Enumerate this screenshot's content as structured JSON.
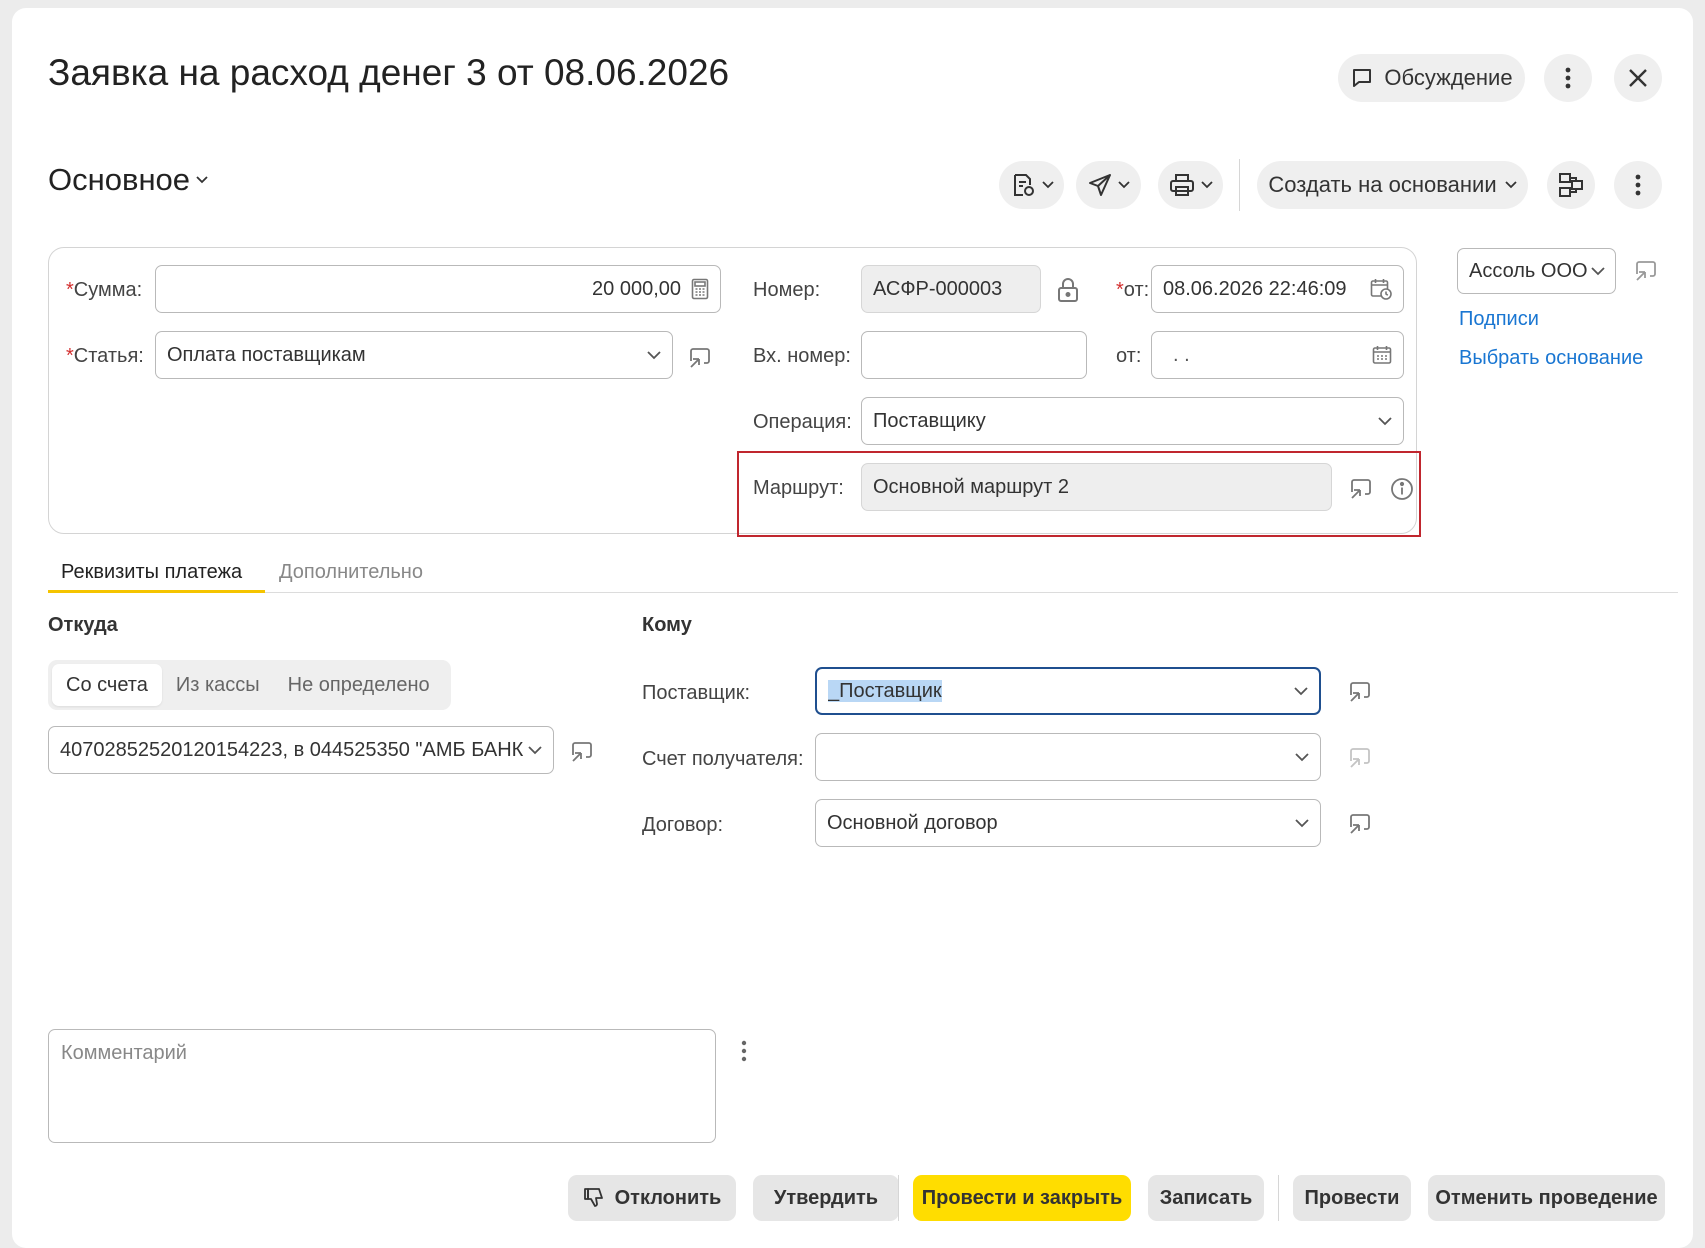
{
  "header": {
    "title": "Заявка на расход денег 3 от 08.06.2026",
    "discussion_label": "Обсуждение"
  },
  "toolbar": {
    "section_label": "Основное",
    "create_based_label": "Создать на основании"
  },
  "form": {
    "sum_label": "Сумма:",
    "sum_value": "20 000,00",
    "article_label": "Статья:",
    "article_value": "Оплата поставщикам",
    "number_label": "Номер:",
    "number_value": "АСФР-000003",
    "from_label": "от:",
    "date_value": "08.06.2026 22:46:09",
    "in_number_label": "Вх. номер:",
    "in_number_value": "",
    "in_from_label": "от:",
    "in_date_value": " .  .",
    "operation_label": "Операция:",
    "operation_value": "Поставщику",
    "route_label": "Маршрут:",
    "route_value": "Основной маршрут 2",
    "required_mark": "*"
  },
  "side": {
    "org_value": "Ассоль ООО",
    "signatures_link": "Подписи",
    "choose_basis_link": "Выбрать основание"
  },
  "tabs": [
    {
      "label": "Реквизиты платежа"
    },
    {
      "label": "Дополнительно"
    }
  ],
  "from_section": {
    "title": "Откуда",
    "segments": [
      "Со счета",
      "Из кассы",
      "Не определено"
    ],
    "account_value": "40702852520120154223, в 044525350 \"АМБ БАНК"
  },
  "to_section": {
    "title": "Кому",
    "supplier_label": "Поставщик:",
    "supplier_value": "_Поставщик",
    "recipient_account_label": "Счет получателя:",
    "recipient_account_value": "",
    "contract_label": "Договор:",
    "contract_value": "Основной договор"
  },
  "comment": {
    "placeholder": "Комментарий"
  },
  "footer": {
    "reject_label": "Отклонить",
    "approve_label": "Утвердить",
    "post_close_label": "Провести и закрыть",
    "save_label": "Записать",
    "post_label": "Провести",
    "unpost_label": "Отменить проведение"
  },
  "colors": {
    "primary_button": "#ffdd00",
    "link": "#1976d2",
    "required": "#d32f2f",
    "highlight_border": "#c0262e",
    "focus_border": "#1f4f8f",
    "tab_active": "#f5c400"
  }
}
